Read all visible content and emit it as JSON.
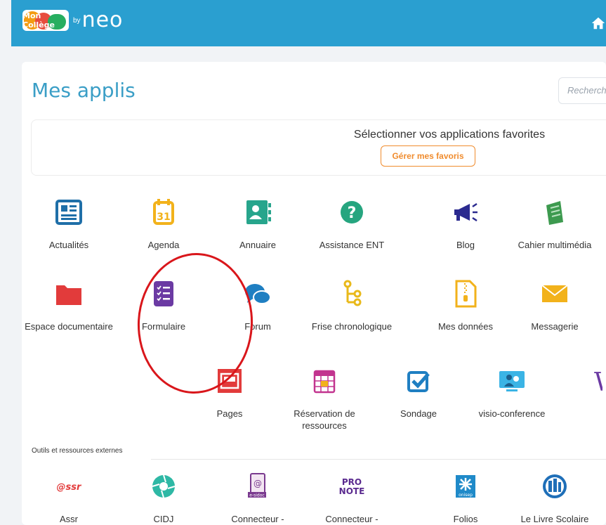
{
  "brand": {
    "logo_text": "Mon Collège",
    "by": "by",
    "name": "neo"
  },
  "header": {
    "title": "Mes applis",
    "search_placeholder": "Recherch"
  },
  "favorites": {
    "title": "Sélectionner vos applications favorites",
    "button": "Gérer mes favoris"
  },
  "apps": [
    {
      "label": "Actualités",
      "icon": "newspaper-icon"
    },
    {
      "label": "Agenda",
      "icon": "calendar-icon"
    },
    {
      "label": "Annuaire",
      "icon": "contact-card-icon"
    },
    {
      "label": "Assistance ENT",
      "icon": "help-icon"
    },
    {
      "label": "Blog",
      "icon": "megaphone-icon"
    },
    {
      "label": "Cahier multimédia",
      "icon": "notebook-icon"
    },
    {
      "label": "Espace documentaire",
      "icon": "folder-icon"
    },
    {
      "label": "Formulaire",
      "icon": "form-checklist-icon"
    },
    {
      "label": "Forum",
      "icon": "chat-bubbles-icon"
    },
    {
      "label": "Frise chronologique",
      "icon": "timeline-icon"
    },
    {
      "label": "Mes données",
      "icon": "zip-file-icon"
    },
    {
      "label": "Messagerie",
      "icon": "envelope-icon"
    },
    {
      "label": "Pages",
      "icon": "pages-icon"
    },
    {
      "label": "Réservation de ressources",
      "icon": "calendar-grid-icon"
    },
    {
      "label": "Sondage",
      "icon": "checkbox-icon"
    },
    {
      "label": "visio-conference",
      "icon": "video-conference-icon"
    },
    {
      "label": "W",
      "icon": "wiki-icon"
    }
  ],
  "external": {
    "section_label": "Outils et ressources externes",
    "items": [
      {
        "label": "Assr",
        "icon": "assr-logo-icon"
      },
      {
        "label": "CIDJ",
        "icon": "cidj-logo-icon"
      },
      {
        "label": "Connecteur -",
        "icon": "esidoc-logo-icon"
      },
      {
        "label": "Connecteur -",
        "icon": "pronote-logo-icon"
      },
      {
        "label": "Folios",
        "icon": "onisep-logo-icon"
      },
      {
        "label": "Le Livre Scolaire",
        "icon": "livre-scolaire-logo-icon"
      }
    ],
    "icon_text": {
      "assr": "@ssr",
      "pronote_line1": "PRO",
      "pronote_line2": "NOTE",
      "onisep": "onisep",
      "esidoc": "e-sidoc"
    }
  },
  "colors": {
    "header": "#2a9fd0",
    "accent": "#f08c2e",
    "title": "#3a9ec6",
    "annotation": "#d9161b"
  }
}
